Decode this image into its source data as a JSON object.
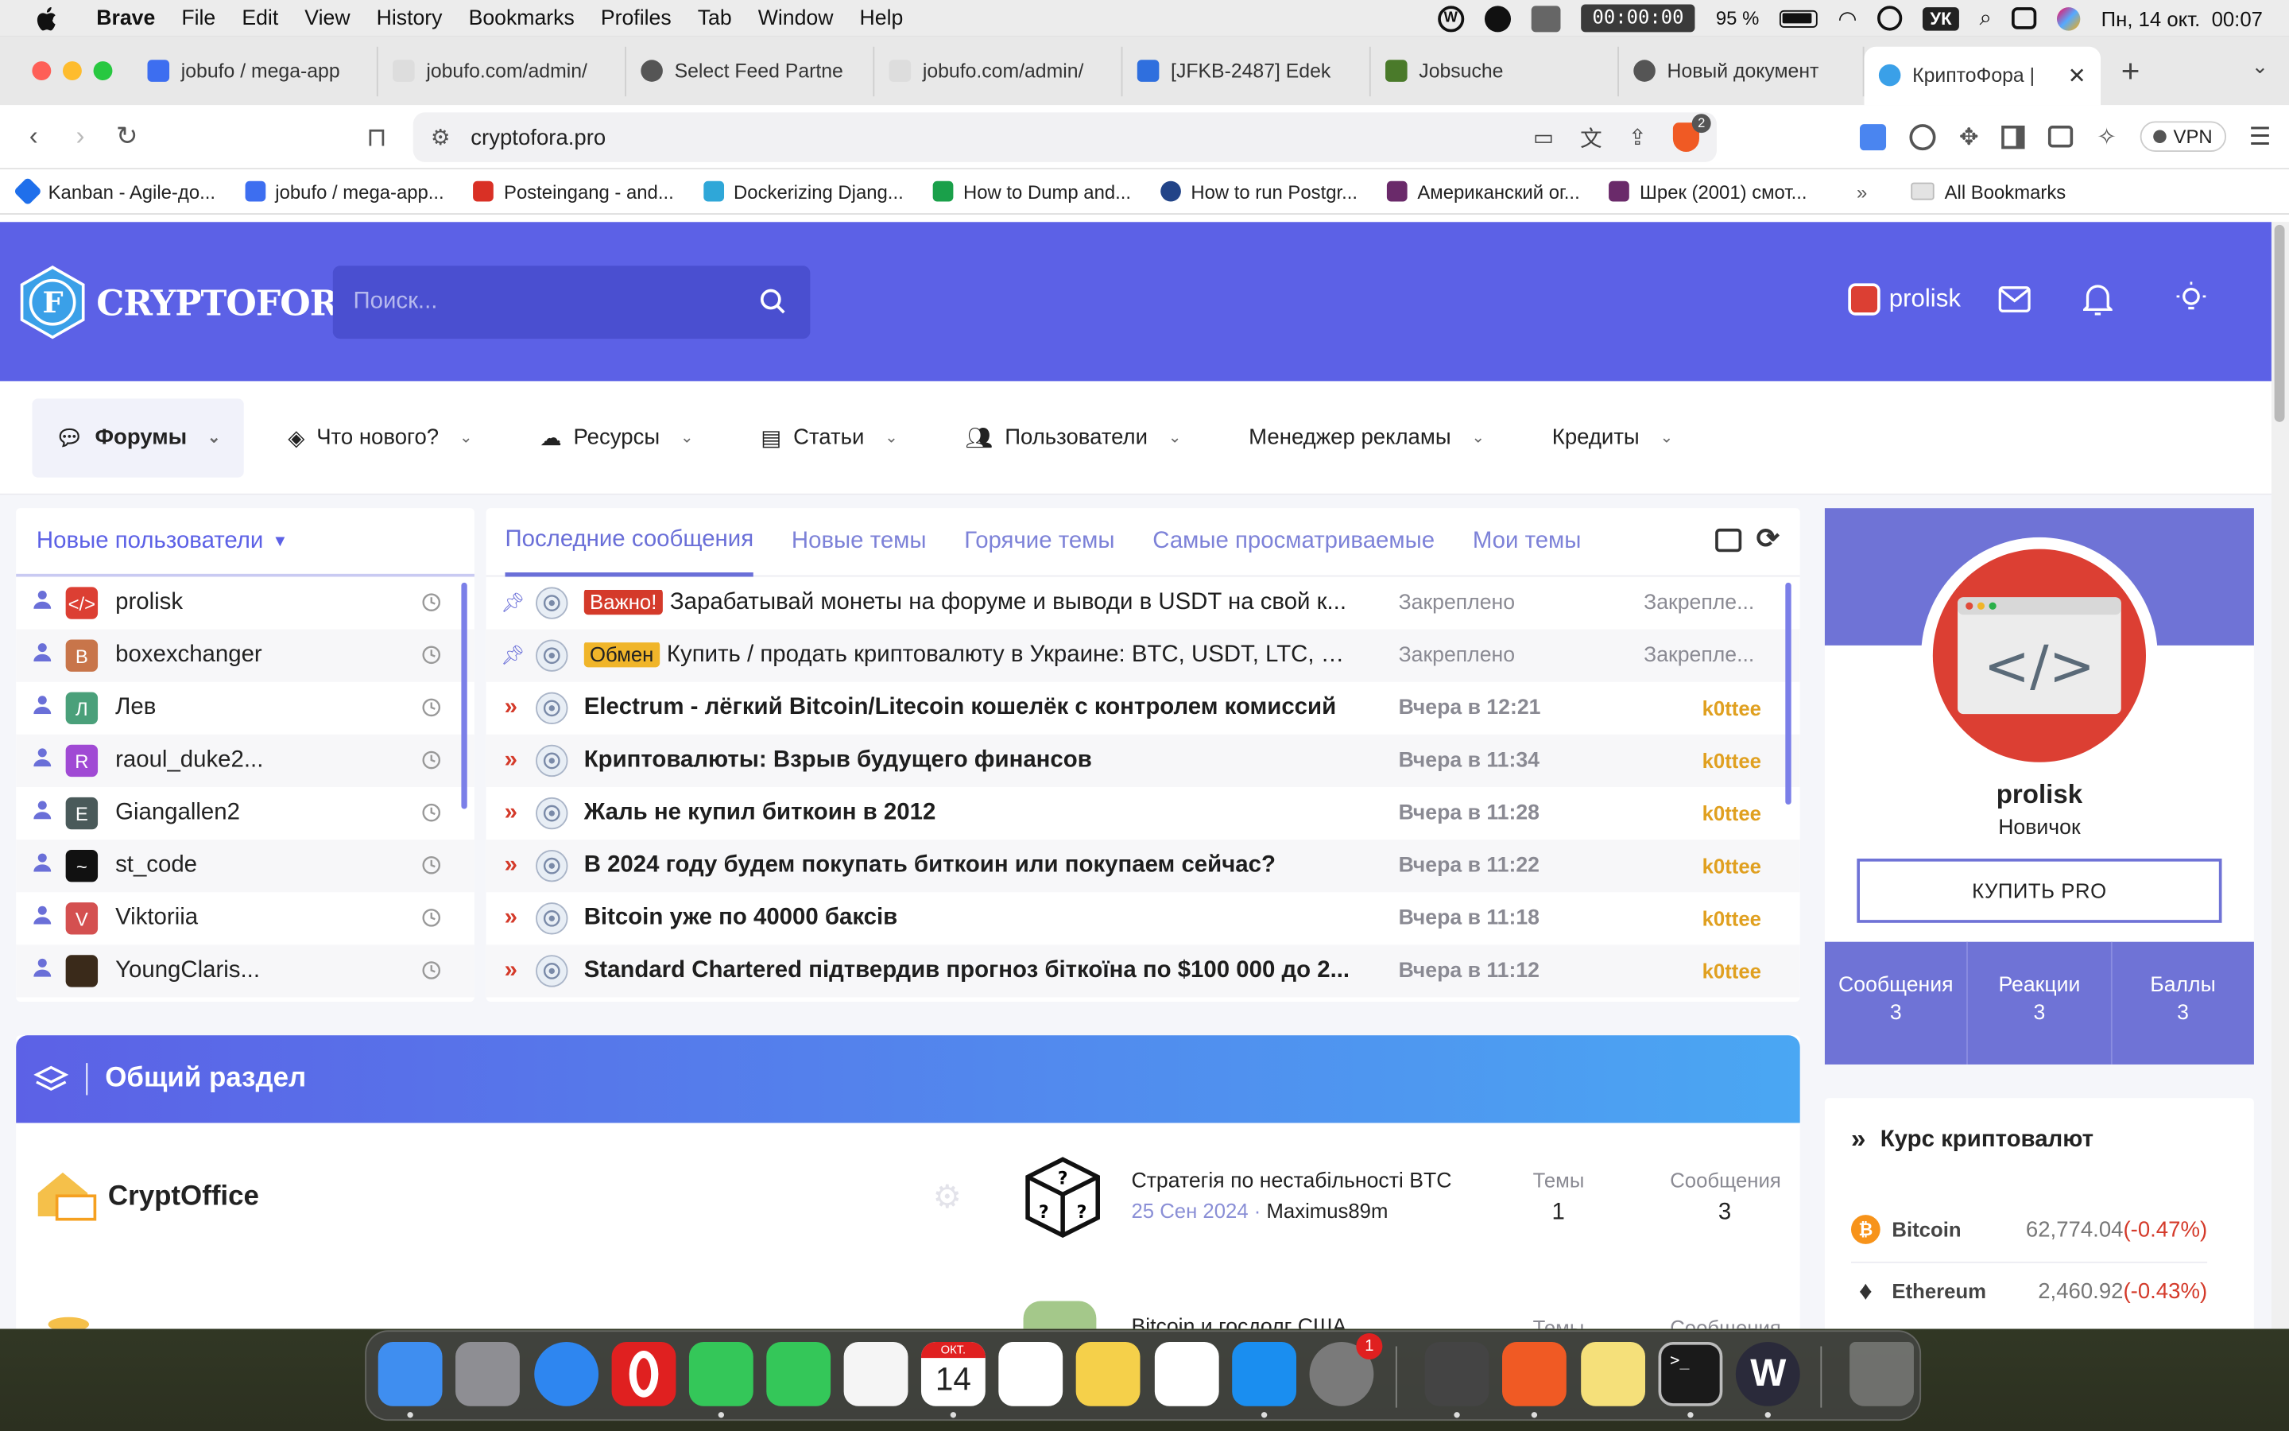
{
  "menubar": {
    "app_name": "Brave",
    "items": [
      "File",
      "Edit",
      "View",
      "History",
      "Bookmarks",
      "Profiles",
      "Tab",
      "Window",
      "Help"
    ],
    "timer": "00:00:00",
    "battery": "95 %",
    "keyboard_layout": "УК",
    "datetime": "Пн, 14 окт.  00:07"
  },
  "tabs": [
    {
      "title": "jobufo / mega-app",
      "color": "#3d6ef0"
    },
    {
      "title": "jobufo.com/admin/",
      "color": "#bbbbbb"
    },
    {
      "title": "Select Feed Partne",
      "color": "#555555"
    },
    {
      "title": "jobufo.com/admin/",
      "color": "#bbbbbb"
    },
    {
      "title": "[JFKB-2487] Edek",
      "color": "#2f6fde"
    },
    {
      "title": "Jobsuche",
      "color": "#4a7a2a"
    },
    {
      "title": "Новый документ",
      "color": "#555555"
    },
    {
      "title": "КриптоФора |",
      "color": "#3aa0e8",
      "active": true
    }
  ],
  "address": {
    "url": "cryptofora.pro",
    "shields_count": "2",
    "vpn_label": "VPN"
  },
  "bookmarks": [
    {
      "title": "Kanban - Agile-до...",
      "color": "#1f6feb"
    },
    {
      "title": "jobufo / mega-app...",
      "color": "#3d6ef0"
    },
    {
      "title": "Posteingang - and...",
      "color": "#d93025"
    },
    {
      "title": "Dockerizing Djang...",
      "color": "#2fa7d8"
    },
    {
      "title": "How to Dump and...",
      "color": "#1aa04a"
    },
    {
      "title": "How to run Postgr...",
      "color": "#224488"
    },
    {
      "title": "Американский ог...",
      "color": "#6a2a6a"
    },
    {
      "title": "Шрек (2001) смот...",
      "color": "#6a2a6a"
    }
  ],
  "bookmarks_all": "All Bookmarks",
  "site": {
    "logo_text": "CRYPTOFORA",
    "search_placeholder": "Поиск...",
    "username": "prolisk",
    "nav": [
      {
        "label": "Форумы",
        "icon": "chat-icon",
        "active": true
      },
      {
        "label": "Что нового?",
        "icon": "layers-icon"
      },
      {
        "label": "Ресурсы",
        "icon": "cloud-download-icon"
      },
      {
        "label": "Статьи",
        "icon": "document-icon"
      },
      {
        "label": "Пользователи",
        "icon": "users-icon"
      },
      {
        "label": "Менеджер рекламы",
        "icon": ""
      },
      {
        "label": "Кредиты",
        "icon": ""
      }
    ]
  },
  "new_users": {
    "title": "Новые пользователи",
    "users": [
      {
        "name": "prolisk",
        "letter": "</>",
        "color": "#dc3f33"
      },
      {
        "name": "boxexchanger",
        "letter": "B",
        "color": "#c8754a"
      },
      {
        "name": "Лев",
        "letter": "Л",
        "color": "#4aa07a"
      },
      {
        "name": "raoul_duke2...",
        "letter": "R",
        "color": "#a04ad4"
      },
      {
        "name": "Giangallen2",
        "letter": "E",
        "color": "#4a5a5a"
      },
      {
        "name": "st_code",
        "letter": "~",
        "color": "#111111"
      },
      {
        "name": "Viktoriia",
        "letter": "V",
        "color": "#d45050"
      },
      {
        "name": "YoungClaris...",
        "letter": "",
        "color": "#3a2a1a"
      }
    ]
  },
  "messages": {
    "tabs": [
      "Последние сообщения",
      "Новые темы",
      "Горячие темы",
      "Самые просматриваемые",
      "Мои темы"
    ],
    "rows": [
      {
        "label": "Важно!",
        "label_color": "#d43a2a",
        "title": "Зарабатывай монеты на форуме и выводи в USDT на свой к...",
        "date": "Закреплено",
        "author": "Закрепле...",
        "pinned": true
      },
      {
        "label": "Обмен",
        "label_color": "#f0b52a",
        "title": "Купить / продать криптовалюту в Украине: BTC, USDT, LTC, E...",
        "date": "Закреплено",
        "author": "Закрепле...",
        "pinned": true
      },
      {
        "label": "",
        "title": "Electrum - лёгкий Bitcoin/Litecoin кошелёк с контролем комиссий",
        "date": "Вчера в 12:21",
        "author": "k0ttee"
      },
      {
        "label": "",
        "title": "Криптовалюты: Взрыв будущего финансов",
        "date": "Вчера в 11:34",
        "author": "k0ttee"
      },
      {
        "label": "",
        "title": "Жаль не купил биткоин в 2012",
        "date": "Вчера в 11:28",
        "author": "k0ttee"
      },
      {
        "label": "",
        "title": "В 2024 году будем покупать биткоин или покупаем сейчас?",
        "date": "Вчера в 11:22",
        "author": "k0ttee"
      },
      {
        "label": "",
        "title": "Bitcoin уже по 40000 баксів",
        "date": "Вчера в 11:18",
        "author": "k0ttee"
      },
      {
        "label": "",
        "title": "Standard Chartered підтвердив прогноз біткоїна по $100 000 до 2...",
        "date": "Вчера в 11:12",
        "author": "k0ttee"
      }
    ]
  },
  "profile": {
    "name": "prolisk",
    "rank": "Новичок",
    "button": "КУПИТЬ PRO",
    "stats": [
      {
        "label": "Сообщения",
        "value": "3"
      },
      {
        "label": "Реакции",
        "value": "3"
      },
      {
        "label": "Баллы",
        "value": "3"
      }
    ]
  },
  "forum": {
    "section_title": "Общий раздел",
    "node_title": "CryptOffice",
    "last_post_title": "Стратегія по нестабільності BTC",
    "last_post_date": "25 Сен 2024",
    "last_post_author": "Maximus89m",
    "themes_label": "Темы",
    "themes_value": "1",
    "posts_label": "Сообщения",
    "posts_value": "3",
    "next_node_title": "Bitcoin и госдолг США",
    "next_themes_label": "Темы",
    "next_posts_label": "Сообщения"
  },
  "crypto": {
    "title": "Курс криптовалют",
    "rows": [
      {
        "name": "Bitcoin",
        "price": "62,774.04",
        "change": "(-0.47%)",
        "color": "#f7931a"
      },
      {
        "name": "Ethereum",
        "price": "2,460.92",
        "change": "(-0.43%)",
        "color": "#555555"
      }
    ]
  },
  "dock": {
    "calendar_month": "ОКТ.",
    "calendar_day": "14",
    "settings_badge": "1",
    "apps": [
      "finder-icon",
      "launchpad-icon",
      "safari-icon",
      "opera-icon",
      "facetime-icon",
      "messages-icon",
      "photos-icon",
      "calendar-icon",
      "reminders-icon",
      "notes-icon",
      "freeform-icon",
      "appstore-icon",
      "settings-icon",
      "sublime-icon",
      "brave-icon",
      "stickies-icon",
      "terminal-icon",
      "winx-icon",
      "trash-icon"
    ]
  }
}
